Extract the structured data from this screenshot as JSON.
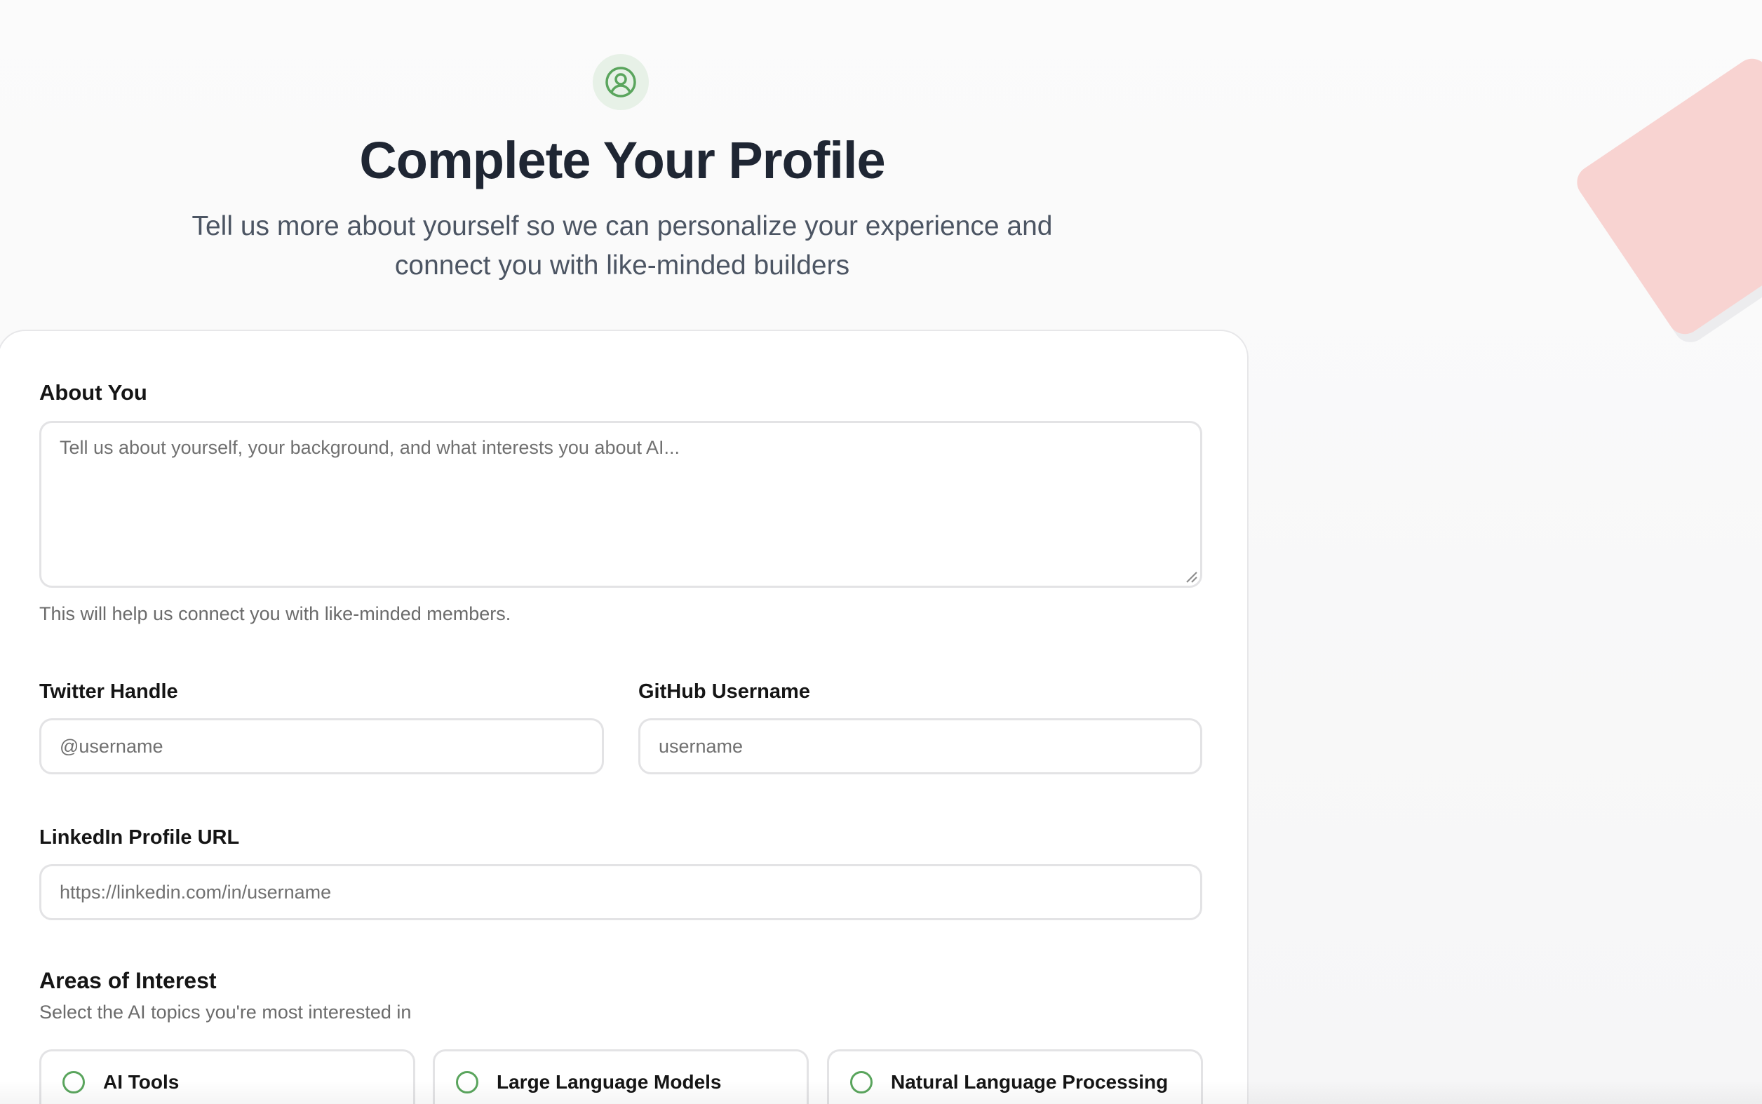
{
  "header": {
    "icon": "user-circle-icon",
    "title": "Complete Your Profile",
    "subtitle": "Tell us more about yourself so we can personalize your experience and connect you with like-minded builders"
  },
  "about": {
    "label": "About You",
    "placeholder": "Tell us about yourself, your background, and what interests you about AI...",
    "value": "",
    "hint": "This will help us connect you with like-minded members."
  },
  "twitter": {
    "label": "Twitter Handle",
    "placeholder": "@username",
    "value": ""
  },
  "github": {
    "label": "GitHub Username",
    "placeholder": "username",
    "value": ""
  },
  "linkedin": {
    "label": "LinkedIn Profile URL",
    "placeholder": "https://linkedin.com/in/username",
    "value": ""
  },
  "interests": {
    "title": "Areas of Interest",
    "subtitle": "Select the AI topics you're most interested in",
    "options": [
      {
        "label": "AI Tools",
        "selected": false
      },
      {
        "label": "Large Language Models",
        "selected": false
      },
      {
        "label": "Natural Language Processing",
        "selected": false
      }
    ]
  },
  "colors": {
    "accent": "#5aa55d",
    "title": "#1f2633",
    "decor": "#f8d3d1"
  }
}
